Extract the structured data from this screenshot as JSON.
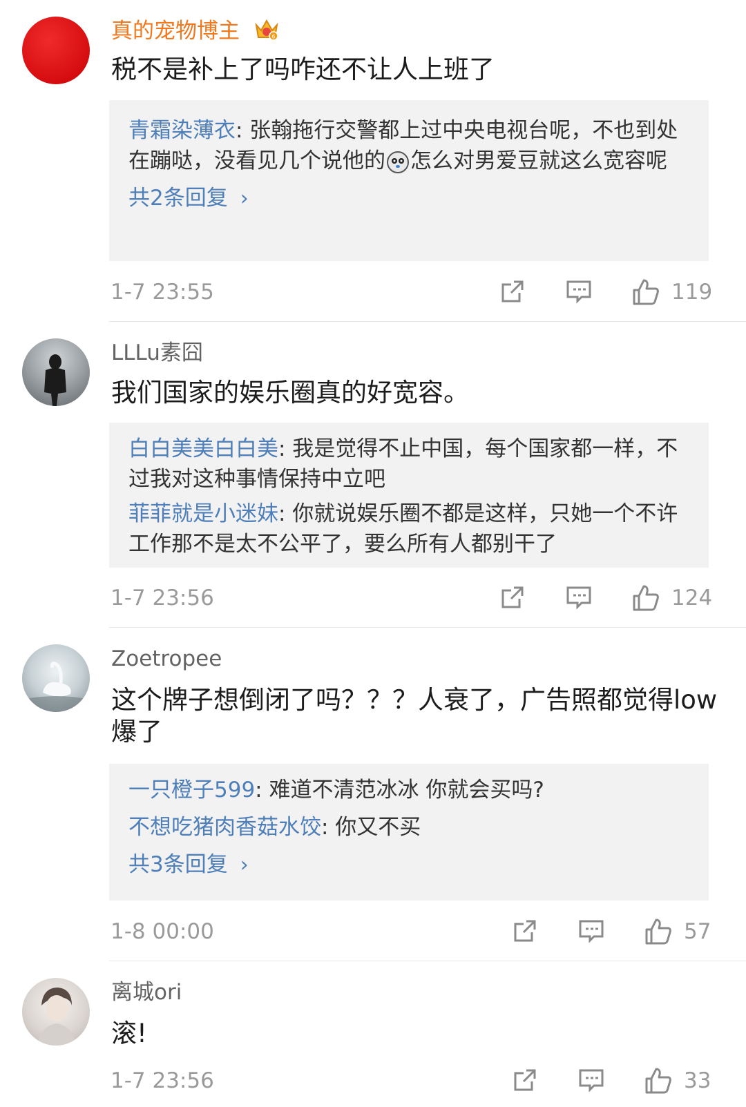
{
  "comments": [
    {
      "username": "真的宠物博主",
      "vip": true,
      "text": "税不是补上了吗咋还不让人上班了",
      "replies": [
        {
          "name": "青霜染薄衣",
          "text_before": ": 张翰拖行交警都上过中央电视台呢，不也到处在蹦哒，没看见几个说他的",
          "emoji": "panda-face-icon",
          "text_after": "怎么对男爱豆就这么宽容呢"
        }
      ],
      "more": "共2条回复",
      "time": "1-7 23:55",
      "likes": "119"
    },
    {
      "username": "LLLu素囧",
      "vip": false,
      "text": "我们国家的娱乐圈真的好宽容。",
      "replies": [
        {
          "name": "白白美美白白美",
          "text": ": 我是觉得不止中国，每个国家都一样，不过我对这种事情保持中立吧"
        },
        {
          "name": "菲菲就是小迷妹",
          "text": ": 你就说娱乐圈不都是这样，只她一个不许工作那不是太不公平了，要么所有人都别干了"
        }
      ],
      "time": "1-7 23:56",
      "likes": "124"
    },
    {
      "username": "Zoetropee",
      "vip": false,
      "text": "这个牌子想倒闭了吗？？？人衰了，广告照都觉得low爆了",
      "replies": [
        {
          "name": "一只橙子599",
          "text": ": 难道不清范冰冰 你就会买吗?"
        },
        {
          "name": "不想吃猪肉香菇水饺",
          "text": ": 你又不买"
        }
      ],
      "more": "共3条回复",
      "time": "1-8 00:00",
      "likes": "57"
    },
    {
      "username": "离城ori",
      "vip": false,
      "text": "滚!",
      "time": "1-7 23:56",
      "likes": "33"
    }
  ],
  "colors": {
    "vip_name": "#f0781e",
    "reply_name": "#4e7fb8",
    "meta": "#9a9a9a",
    "reply_bg": "#f2f2f2"
  },
  "icons": [
    "crown-badge-icon",
    "share-icon",
    "comment-icon",
    "like-icon"
  ]
}
